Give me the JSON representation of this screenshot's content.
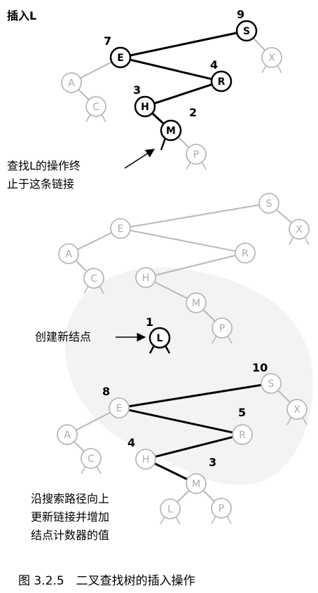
{
  "title": "插入L",
  "annotations": {
    "search_end_line1": "查找L的操作终",
    "search_end_line2": "止于这条链接",
    "create_node": "创建新结点",
    "update_line1": "沿搜索路径向上",
    "update_line2": "更新链接并增加",
    "update_line3": "结点计数器的值"
  },
  "caption": "图 3.2.5　二叉查找树的插入操作",
  "panels": [
    {
      "id": "search",
      "nodes": [
        {
          "key": "S",
          "count": "9",
          "highlight": true
        },
        {
          "key": "X",
          "count": "",
          "highlight": false
        },
        {
          "key": "E",
          "count": "7",
          "highlight": true
        },
        {
          "key": "A",
          "count": "",
          "highlight": false
        },
        {
          "key": "C",
          "count": "",
          "highlight": false
        },
        {
          "key": "R",
          "count": "4",
          "highlight": true
        },
        {
          "key": "H",
          "count": "3",
          "highlight": true
        },
        {
          "key": "M",
          "count": "2",
          "highlight": true
        },
        {
          "key": "P",
          "count": "",
          "highlight": false
        }
      ]
    },
    {
      "id": "create",
      "nodes": [
        {
          "key": "S",
          "count": "",
          "highlight": false
        },
        {
          "key": "X",
          "count": "",
          "highlight": false
        },
        {
          "key": "E",
          "count": "",
          "highlight": false
        },
        {
          "key": "A",
          "count": "",
          "highlight": false
        },
        {
          "key": "C",
          "count": "",
          "highlight": false
        },
        {
          "key": "R",
          "count": "",
          "highlight": false
        },
        {
          "key": "H",
          "count": "",
          "highlight": false
        },
        {
          "key": "M",
          "count": "",
          "highlight": false
        },
        {
          "key": "P",
          "count": "",
          "highlight": false
        },
        {
          "key": "L",
          "count": "1",
          "highlight": true
        }
      ]
    },
    {
      "id": "update",
      "nodes": [
        {
          "key": "S",
          "count": "10",
          "highlight": false
        },
        {
          "key": "X",
          "count": "",
          "highlight": false
        },
        {
          "key": "E",
          "count": "8",
          "highlight": false
        },
        {
          "key": "A",
          "count": "",
          "highlight": false
        },
        {
          "key": "C",
          "count": "",
          "highlight": false
        },
        {
          "key": "R",
          "count": "5",
          "highlight": false
        },
        {
          "key": "H",
          "count": "4",
          "highlight": false
        },
        {
          "key": "M",
          "count": "3",
          "highlight": false
        },
        {
          "key": "L",
          "count": "",
          "highlight": false
        },
        {
          "key": "P",
          "count": "",
          "highlight": false
        }
      ]
    }
  ]
}
